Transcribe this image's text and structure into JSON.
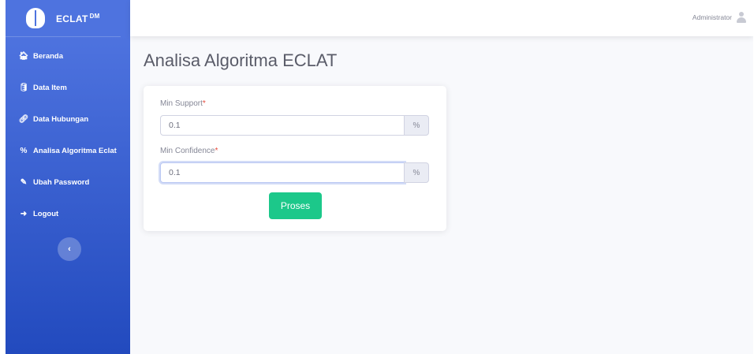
{
  "brand": {
    "name": "ECLAT",
    "sup": "DM"
  },
  "sidebar": {
    "items": [
      {
        "icon": "home-icon",
        "glyph": "🏠︎",
        "label": "Beranda"
      },
      {
        "icon": "database-icon",
        "glyph": "🛢︎",
        "label": "Data Item"
      },
      {
        "icon": "link-icon",
        "glyph": "🔗︎",
        "label": "Data Hubungan"
      },
      {
        "icon": "percent-icon",
        "glyph": "%",
        "label": "Analisa Algoritma Eclat"
      },
      {
        "icon": "edit-icon",
        "glyph": "✎",
        "label": "Ubah Password"
      },
      {
        "icon": "logout-icon",
        "glyph": "➜",
        "label": "Logout"
      }
    ],
    "toggle_glyph": "‹"
  },
  "topbar": {
    "user_name": "Administrator",
    "user_icon": "user-icon"
  },
  "page": {
    "title": "Analisa Algoritma ECLAT"
  },
  "form": {
    "min_support": {
      "label": "Min Support",
      "required_mark": "*",
      "value": "0.1",
      "unit": "%"
    },
    "min_confidence": {
      "label": "Min Confidence",
      "required_mark": "*",
      "value": "0.1",
      "unit": "%"
    },
    "submit_label": "Proses"
  },
  "colors": {
    "sidebar": "#4e73df",
    "submit": "#1cc88a",
    "required": "#e74a3b"
  }
}
